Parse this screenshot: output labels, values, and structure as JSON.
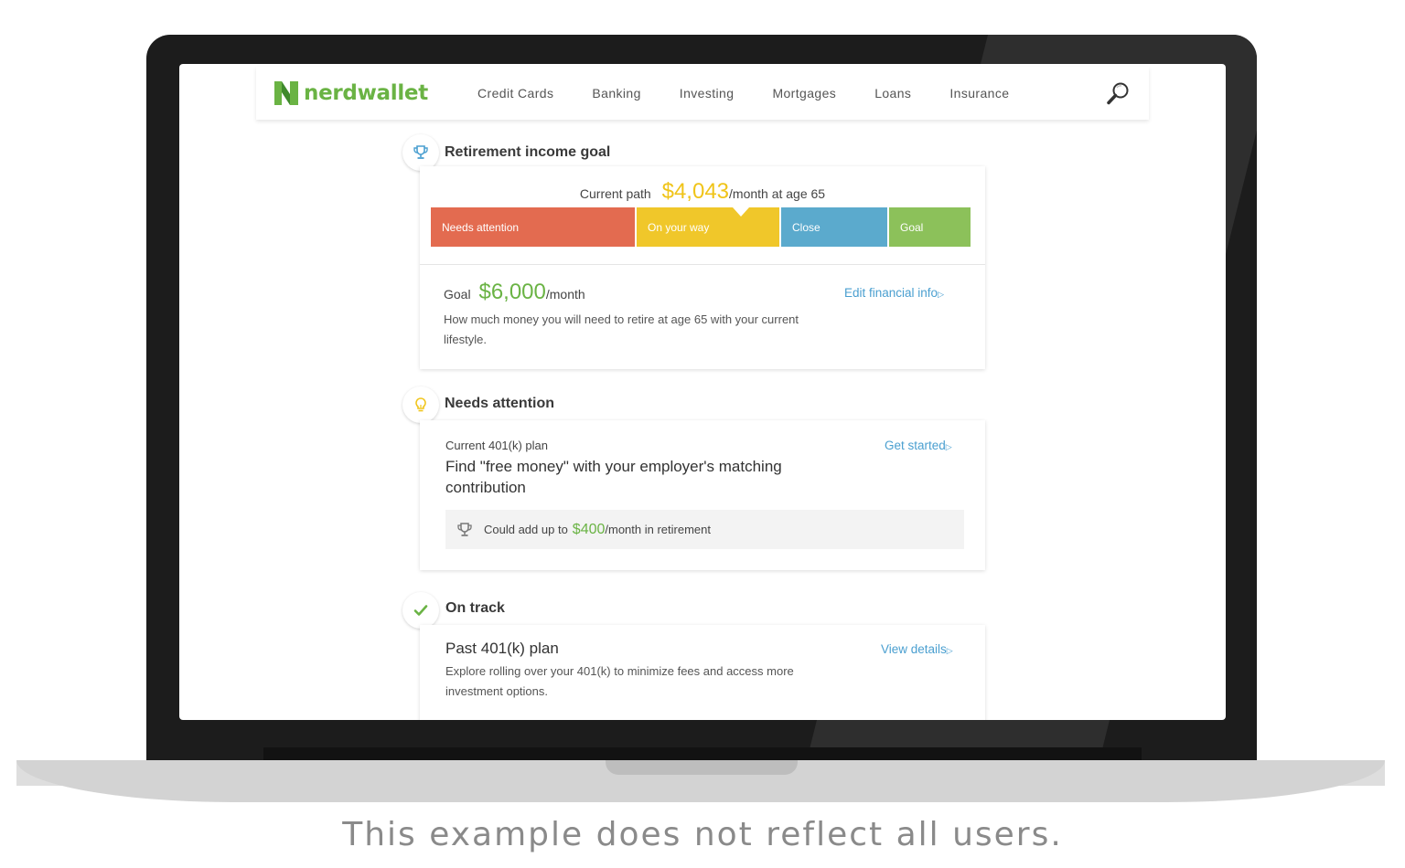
{
  "header": {
    "brand": "nerdwallet",
    "nav": [
      "Credit Cards",
      "Banking",
      "Investing",
      "Mortgages",
      "Loans",
      "Insurance"
    ]
  },
  "retirement": {
    "title": "Retirement income goal",
    "current_path_label": "Current path",
    "current_path_value": "$4,043",
    "current_path_unit": "/month at age 65",
    "meter": [
      {
        "label": "Needs attention",
        "color": "#e36b50"
      },
      {
        "label": "On your way",
        "color": "#f0c72a"
      },
      {
        "label": "Close",
        "color": "#5baacd"
      },
      {
        "label": "Goal",
        "color": "#8cc15a"
      }
    ],
    "goal_label": "Goal",
    "goal_value": "$6,000",
    "goal_unit": "/month",
    "goal_desc_1": "How much money you will need to retire at age 65 with your current",
    "goal_desc_2": "lifestyle.",
    "edit_link": "Edit financial info"
  },
  "needs_attention": {
    "title": "Needs attention",
    "subtitle": "Current 401(k) plan",
    "headline_1": "Find \"free money\" with your employer's matching",
    "headline_2": "contribution",
    "link": "Get started",
    "callout_prefix": "Could add up to",
    "callout_value": "$400",
    "callout_suffix": "/month in retirement"
  },
  "on_track": {
    "title": "On track",
    "headline": "Past 401(k) plan",
    "desc_1": "Explore rolling over your 401(k) to minimize fees and access more",
    "desc_2": "investment options.",
    "link": "View details"
  },
  "caption": "This example does not reflect all users.",
  "colors": {
    "brand_green": "#6ab344",
    "link_blue": "#4a9fd0",
    "accent_yellow": "#f0c419"
  }
}
